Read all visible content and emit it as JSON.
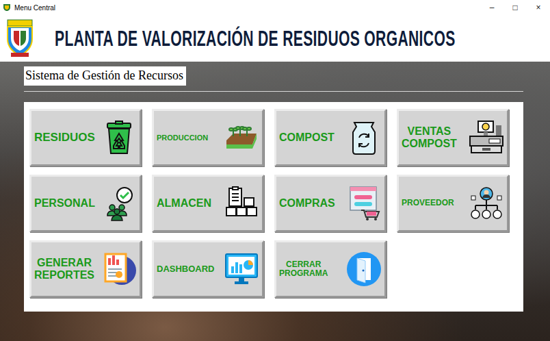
{
  "window": {
    "title": "Menu Central",
    "controls": [
      "–",
      "□",
      "×"
    ]
  },
  "header": {
    "title": "PLANTA DE VALORIZACIÓN DE RESIDUOS ORGANICOS"
  },
  "subtitle": "Sistema de Gestión de Recursos",
  "buttons": [
    {
      "label": "RESIDUOS"
    },
    {
      "label": "PRODUCCION"
    },
    {
      "label": "COMPOST"
    },
    {
      "label": "VENTAS\nCOMPOST"
    },
    {
      "label": "PERSONAL"
    },
    {
      "label": "ALMACEN"
    },
    {
      "label": "COMPRAS"
    },
    {
      "label": "PROVEEDOR"
    },
    {
      "label": "GENERAR\nREPORTES"
    },
    {
      "label": "DASHBOARD"
    },
    {
      "label": "CERRAR\nPROGRAMA"
    }
  ]
}
